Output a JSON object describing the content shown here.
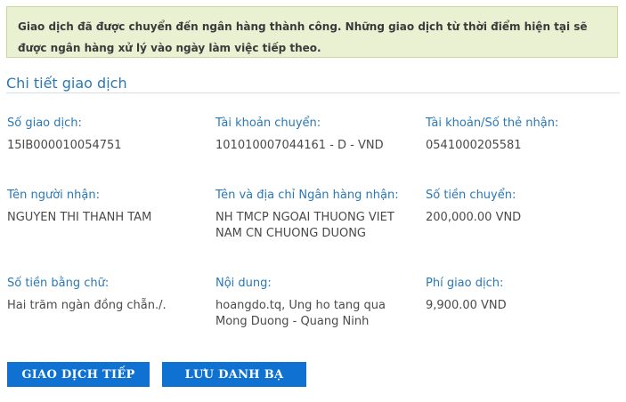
{
  "notice": {
    "text": "Giao dịch đã được chuyển đến ngân hàng thành công. Những giao dịch từ thời điểm hiện tại sẽ được ngân hàng xử lý vào ngày làm việc tiếp theo."
  },
  "section": {
    "title": "Chi tiết giao dịch"
  },
  "details": {
    "transaction_id": {
      "label": "Số giao dịch:",
      "value": "15IB000010054751"
    },
    "from_account": {
      "label": "Tài khoản chuyển:",
      "value": "101010007044161 - D - VND"
    },
    "to_account": {
      "label": "Tài khoản/Số thẻ nhận:",
      "value": "0541000205581"
    },
    "recipient_name": {
      "label": "Tên người nhận:",
      "value": "NGUYEN THI THANH TAM"
    },
    "recipient_bank": {
      "label": "Tên và địa chỉ Ngân hàng nhận:",
      "value": "NH TMCP NGOAI THUONG VIET NAM CN CHUONG DUONG"
    },
    "amount": {
      "label": "Số tiền chuyển:",
      "value": "200,000.00 VND"
    },
    "amount_words": {
      "label": "Số tiền bằng chữ:",
      "value": "Hai trăm ngàn đồng chẵn./."
    },
    "content": {
      "label": "Nội dung:",
      "value": "hoangdo.tq, Ung ho tang qua Mong Duong - Quang Ninh"
    },
    "fee": {
      "label": "Phí giao dịch:",
      "value": "9,900.00 VND"
    }
  },
  "buttons": {
    "continue": "GIAO DỊCH TIẾP",
    "save_contact": "LƯU DANH BẠ"
  },
  "colors": {
    "accent": "#2a78b6",
    "button": "#0f72d2",
    "notice_bg": "#eaf1d2"
  }
}
